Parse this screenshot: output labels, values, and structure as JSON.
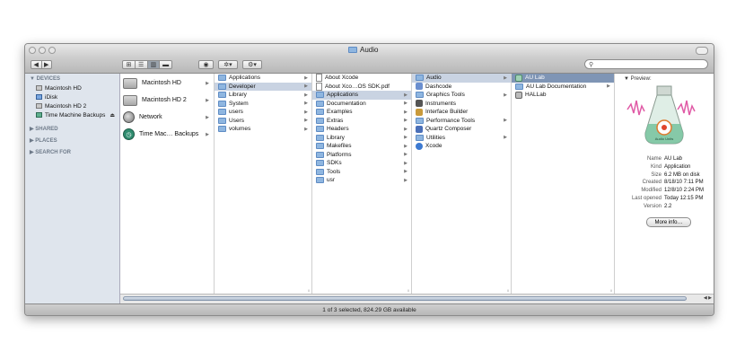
{
  "window": {
    "title": "Audio"
  },
  "toolbar": {
    "back": "◀",
    "forward": "▶",
    "view_icons": "⊞",
    "view_list": "☰",
    "view_columns": "▥",
    "view_coverflow": "▬",
    "quicklook": "◉",
    "action": "✲▾",
    "arrange": "⚙▾",
    "search_glass": "🔍",
    "search_placeholder": ""
  },
  "sidebar": {
    "devices_label": "▼ DEVICES",
    "devices": [
      {
        "label": "Macintosh HD"
      },
      {
        "label": "iDisk"
      },
      {
        "label": "Macintosh HD 2"
      },
      {
        "label": "Time Machine Backups"
      }
    ],
    "eject": "⏏",
    "shared": "▶ SHARED",
    "places": "▶ PLACES",
    "search_for": "▶ SEARCH FOR"
  },
  "columns": {
    "volumes": [
      "Macintosh HD",
      "Macintosh HD 2",
      "Network",
      "Time Mac… Backups"
    ],
    "root": [
      "Applications",
      "Developer",
      "Library",
      "System",
      "users",
      "Users",
      "volumes"
    ],
    "developer": [
      "About Xcode",
      "About Xco…OS SDK.pdf",
      "Applications",
      "Documentation",
      "Examples",
      "Extras",
      "Headers",
      "Library",
      "Makefiles",
      "Platforms",
      "SDKs",
      "Tools",
      "usr"
    ],
    "applications": [
      "Audio",
      "Dashcode",
      "Graphics Tools",
      "Instruments",
      "Interface Builder",
      "Performance Tools",
      "Quartz Composer",
      "Utilities",
      "Xcode"
    ],
    "audio": [
      "AU Lab",
      "AU Lab Documentation",
      "HALLab"
    ]
  },
  "preview": {
    "header": "▼ Preview:",
    "icon_text": "Audio Units",
    "meta": [
      {
        "label": "Name",
        "value": "AU Lab"
      },
      {
        "label": "Kind",
        "value": "Application"
      },
      {
        "label": "Size",
        "value": "6.2 MB on disk"
      },
      {
        "label": "Created",
        "value": "8/18/10 7:11 PM"
      },
      {
        "label": "Modified",
        "value": "12/8/10 2:24 PM"
      },
      {
        "label": "Last opened",
        "value": "Today 12:15 PM"
      },
      {
        "label": "Version",
        "value": "2.2"
      }
    ],
    "more_info": "More info…"
  },
  "status": {
    "text": "1 of 3 selected, 824.29 GB available"
  },
  "colors": {
    "selection_active": "#7f95b5",
    "selection_inactive": "#c9d3e2",
    "sidebar_bg": "#dfe5ed"
  }
}
